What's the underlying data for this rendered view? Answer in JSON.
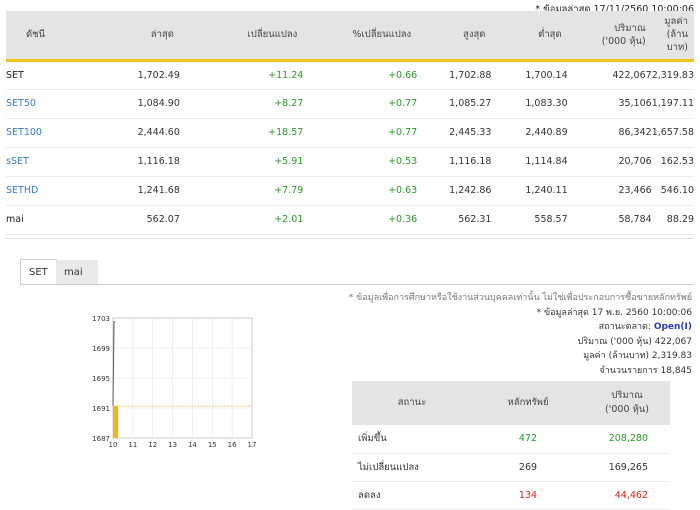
{
  "timestamp": "* ข้อมูลล่าสุด 17/11/2560 10:00:06",
  "index_table": {
    "headers": [
      "ดัชนี",
      "ล่าสุด",
      "เปลี่ยนแปลง",
      "%เปลี่ยนแปลง",
      "สูงสุด",
      "ต่ำสุด",
      "ปริมาณ\n('000 หุ้น)",
      "มูลค่า\n(ล้านบาท)"
    ],
    "header_lines": {
      "volume_1": "ปริมาณ",
      "volume_2": "('000 หุ้น)",
      "value_1": "มูลค่า",
      "value_2": "(ล้านบาท)"
    },
    "rows": [
      {
        "name": "SET",
        "last": "1,702.49",
        "chg": "+11.24",
        "pct": "+0.66",
        "high": "1,702.88",
        "low": "1,700.14",
        "vol": "422,067",
        "val": "2,319.83"
      },
      {
        "name": "SET50",
        "last": "1,084.90",
        "chg": "+8.27",
        "pct": "+0.77",
        "high": "1,085.27",
        "low": "1,083.30",
        "vol": "35,106",
        "val": "1,197.11"
      },
      {
        "name": "SET100",
        "last": "2,444.60",
        "chg": "+18.57",
        "pct": "+0.77",
        "high": "2,445.33",
        "low": "2,440.89",
        "vol": "86,342",
        "val": "1,657.58"
      },
      {
        "name": "sSET",
        "last": "1,116.18",
        "chg": "+5.91",
        "pct": "+0.53",
        "high": "1,116.18",
        "low": "1,114.84",
        "vol": "20,706",
        "val": "162.53"
      },
      {
        "name": "SETHD",
        "last": "1,241.68",
        "chg": "+7.79",
        "pct": "+0.63",
        "high": "1,242.86",
        "low": "1,240.11",
        "vol": "23,466",
        "val": "546.10"
      },
      {
        "name": "mai",
        "last": "562.07",
        "chg": "+2.01",
        "pct": "+0.36",
        "high": "562.31",
        "low": "558.57",
        "vol": "58,784",
        "val": "88.29"
      }
    ]
  },
  "tabs": [
    "SET",
    "mai"
  ],
  "chart_data": {
    "type": "line",
    "x_ticks": [
      "10",
      "11",
      "12",
      "13",
      "14",
      "15",
      "16",
      "17"
    ],
    "y_ticks": [
      "1703",
      "1699",
      "1695",
      "1691",
      "1687"
    ],
    "ylim": [
      1687,
      1703
    ],
    "xlim": [
      10,
      17
    ],
    "reference_line": 1691.25,
    "series": [
      {
        "x": [
          10.0,
          10.05,
          10.1
        ],
        "y": [
          1691.3,
          1702.5,
          1702.5
        ]
      }
    ],
    "colors": {
      "line": "#555555",
      "fill": "#f5b800",
      "reference": "#e6c45a"
    }
  },
  "info": {
    "disclaimer": "* ข้อมูลเพื่อการศึกษาหรือใช้งานส่วนบุคคลเท่านั้น ไม่ใช่เพื่อประกอบการซื้อขายหลักทรัพย์",
    "updated": "* ข้อมูลล่าสุด 17 พ.ย. 2560 10:00:06",
    "status_label": "สถานะตลาด:",
    "status_value": "Open(I)",
    "volume_label": "ปริมาณ ('000 หุ้น)",
    "volume_value": "422,067",
    "value_label": "มูลค่า (ล้านบาท)",
    "value_value": "2,319.83",
    "deals_label": "จำนวนรายการ",
    "deals_value": "18,845"
  },
  "status_table": {
    "h_status": "สถานะ",
    "h_securities": "หลักทรัพย์",
    "h_volume_1": "ปริมาณ",
    "h_volume_2": "('000 หุ้น)",
    "rows": [
      {
        "label": "เพิ่มขึ้น",
        "count": "472",
        "volume": "208,280"
      },
      {
        "label": "ไม่เปลี่ยนแปลง",
        "count": "269",
        "volume": "169,265"
      },
      {
        "label": "ลดลง",
        "count": "134",
        "volume": "44,462"
      }
    ]
  }
}
